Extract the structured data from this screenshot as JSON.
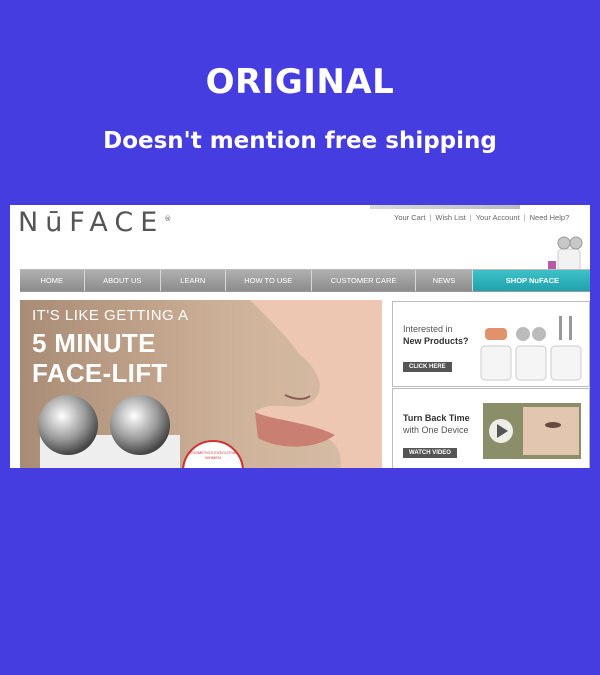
{
  "header": {
    "title": "ORIGINAL",
    "subtitle": "Doesn't mention free shipping"
  },
  "site": {
    "logo": "NūFACE",
    "top_links": [
      "Your Cart",
      "Wish List",
      "Your Account",
      "Need Help?"
    ],
    "nav": [
      {
        "label": "HOME",
        "active": false
      },
      {
        "label": "ABOUT US",
        "active": false
      },
      {
        "label": "LEARN",
        "active": false
      },
      {
        "label": "HOW TO USE",
        "active": false
      },
      {
        "label": "CUSTOMER CARE",
        "active": false
      },
      {
        "label": "NEWS",
        "active": false
      },
      {
        "label": "SHOP NuFACE",
        "active": true
      }
    ],
    "hero": {
      "line1": "IT'S LIKE GETTING A",
      "line2": "5 MINUTE",
      "line3": "FACE-LIFT",
      "badge": "COSMETICS EXECUTIVE WOMEN"
    },
    "promo1": {
      "line1": "Interested in",
      "line2": "New Products?",
      "button": "CLICK HERE"
    },
    "promo2": {
      "line1": "Turn Back Time",
      "line2": "with One Device",
      "button": "WATCH VIDEO"
    }
  },
  "colors": {
    "background": "#463de0",
    "nav_active": "#2bb3bd",
    "nav_default": "#9e9e9e"
  }
}
